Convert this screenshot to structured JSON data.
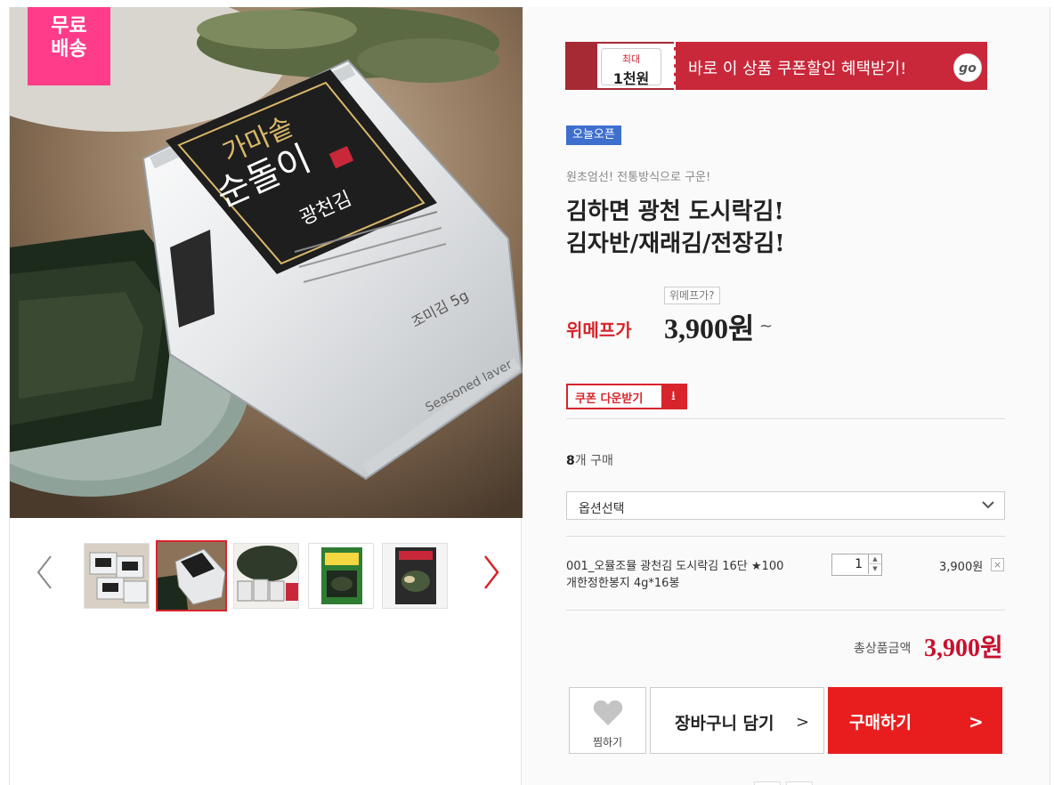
{
  "gallery": {
    "badge_line1": "무료",
    "badge_line2": "배송",
    "thumbnails": [
      {
        "icon": "product-thumb-1",
        "active": false
      },
      {
        "icon": "product-thumb-2",
        "active": true
      },
      {
        "icon": "product-thumb-3",
        "active": false
      },
      {
        "icon": "product-thumb-4",
        "active": false
      },
      {
        "icon": "product-thumb-5",
        "active": false
      }
    ],
    "prev_icon": "chevron-left-icon",
    "next_icon": "chevron-right-icon"
  },
  "coupon_banner": {
    "small": "최대",
    "big": "1천원",
    "text": "바로 이 상품 쿠폰할인 혜택받기!",
    "go": "go"
  },
  "product": {
    "badge": "오늘오픈",
    "subtitle": "원초엄선! 전통방식으로 구운!",
    "title_line1": "김하면 광천 도시락김!",
    "title_line2": "김자반/재래김/전장김!",
    "price_help": "위메프가?",
    "price_label": "위메프가",
    "price": "3,900원",
    "price_suffix": "~"
  },
  "coupon_download": {
    "label": "쿠폰 다운받기",
    "icon": "download-icon"
  },
  "purchase": {
    "count_number": "8",
    "count_text": "개 구매",
    "option_placeholder": "옵션선택",
    "selected_option": {
      "name_line1": "001_오뮬조뮬 광천김 도시락김 16단 ★100",
      "name_line2": "개한정한봉지 4g*16봉",
      "quantity": "1",
      "price": "3,900원",
      "remove": "×"
    },
    "total_label": "총상품금액",
    "total_value": "3,900원"
  },
  "actions": {
    "wish": "찜하기",
    "cart": "장바구니 담기",
    "cart_arrow": ">",
    "buy": "구매하기",
    "buy_arrow": ">"
  },
  "colors": {
    "accent_red": "#d8242b",
    "buy_red": "#e81e1e",
    "badge_pink": "#ff3c8a",
    "badge_blue": "#3e6fce",
    "coupon_banner_red": "#c8283a"
  }
}
